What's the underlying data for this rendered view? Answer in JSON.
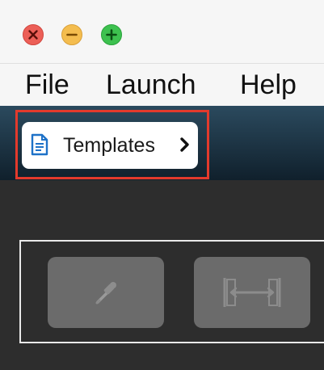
{
  "window": {
    "controls": [
      "close-icon",
      "minimize-icon",
      "maximize-icon"
    ],
    "colors": {
      "close": "#ec5f57",
      "minimize": "#f4bd4f",
      "maximize": "#3dc14f"
    }
  },
  "menubar": {
    "items": [
      {
        "label": "File"
      },
      {
        "label": "Launch"
      },
      {
        "label": "Help"
      }
    ]
  },
  "toolbar": {
    "templates_button": {
      "label": "Templates",
      "icon": "document-icon",
      "chevron": "chevron-right-icon"
    },
    "highlight_color": "#e33a2c"
  },
  "tools": [
    {
      "icon": "eyedropper-icon",
      "enabled": false
    },
    {
      "icon": "measure-width-icon",
      "enabled": false
    }
  ]
}
